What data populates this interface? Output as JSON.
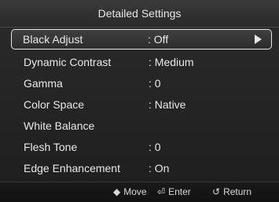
{
  "title": "Detailed Settings",
  "menu": [
    {
      "label": "Black Adjust",
      "value": ": Off"
    },
    {
      "label": "Dynamic Contrast",
      "value": ": Medium"
    },
    {
      "label": "Gamma",
      "value": ": 0"
    },
    {
      "label": "Color Space",
      "value": ": Native"
    },
    {
      "label": "White Balance",
      "value": ""
    },
    {
      "label": "Flesh Tone",
      "value": ": 0"
    },
    {
      "label": "Edge Enhancement",
      "value": ": On"
    }
  ],
  "selected_index": 0,
  "hints": {
    "move": {
      "icon": "◆",
      "label": "Move",
      "icon_name": "up-down-arrows-icon"
    },
    "enter": {
      "icon": "⏎",
      "label": "Enter",
      "icon_name": "enter-icon"
    },
    "return": {
      "icon": "↺",
      "label": "Return",
      "icon_name": "return-icon"
    }
  }
}
